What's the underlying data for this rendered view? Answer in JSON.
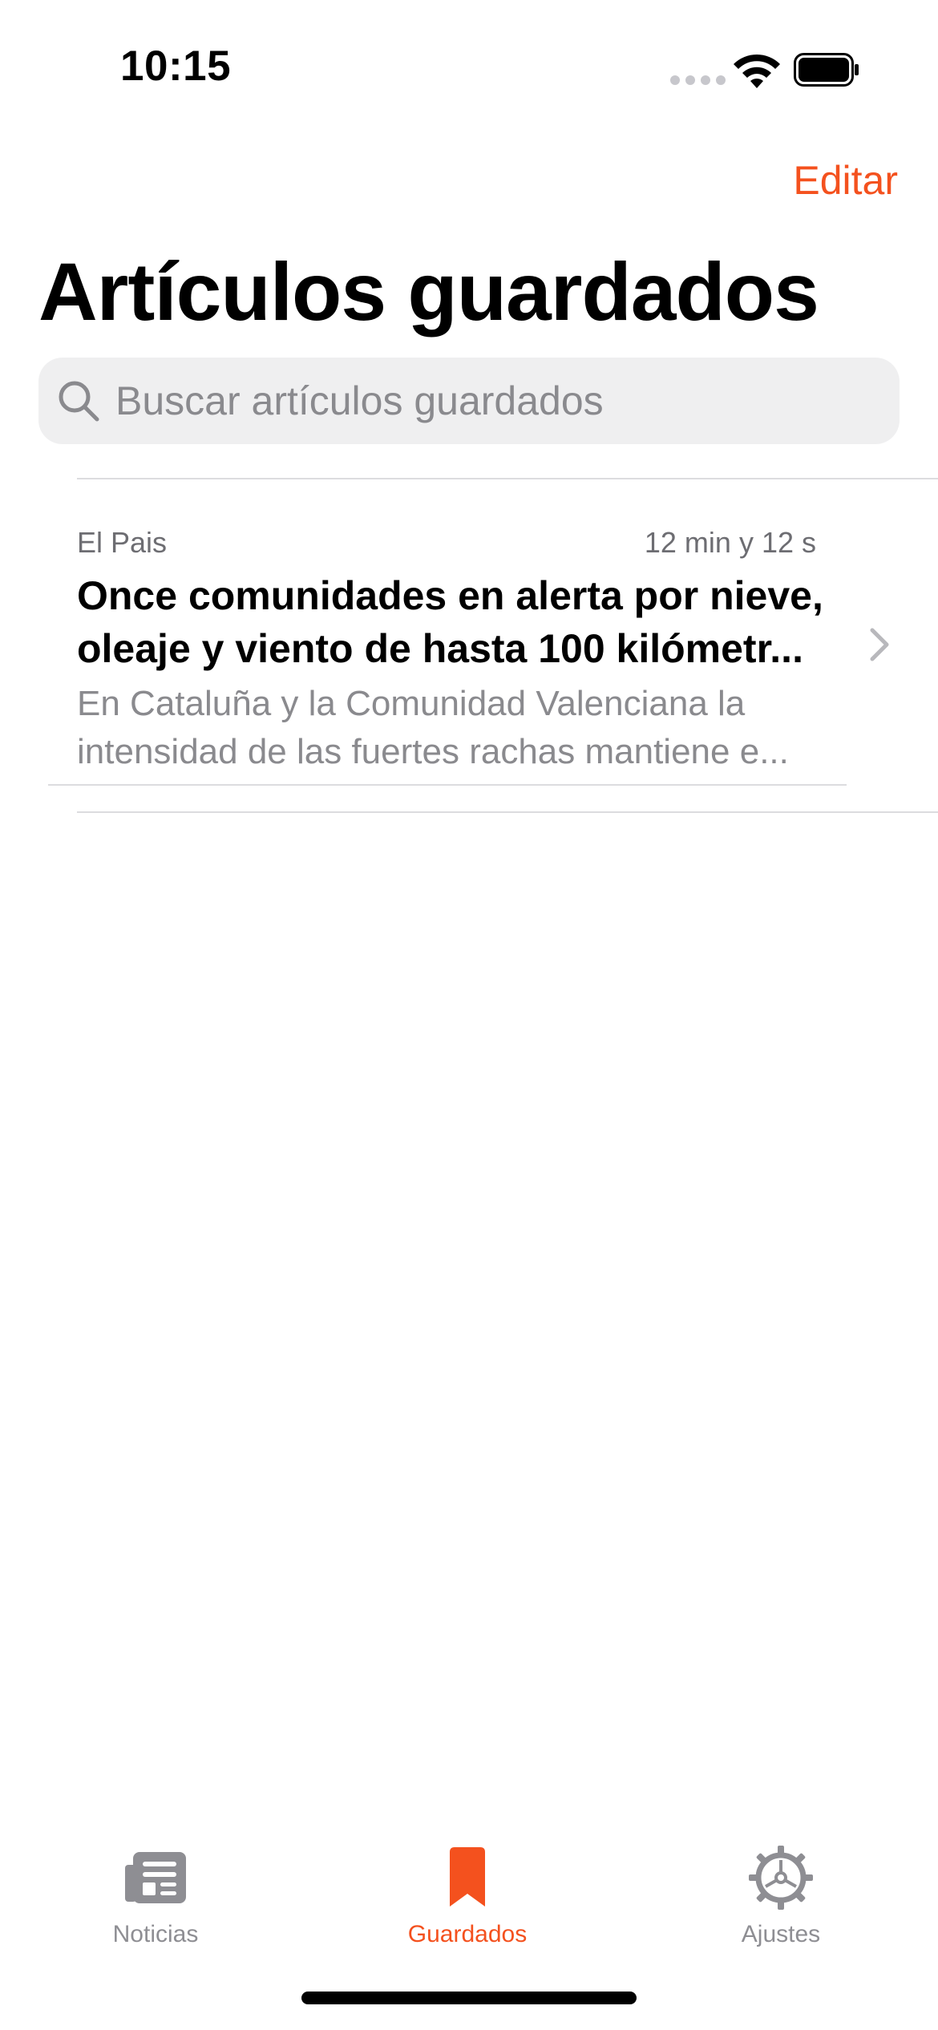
{
  "status_bar": {
    "time": "10:15"
  },
  "nav": {
    "edit_label": "Editar",
    "title": "Artículos guardados"
  },
  "search": {
    "placeholder": "Buscar artículos guardados"
  },
  "articles": [
    {
      "source": "El Pais",
      "time": "12 min y 12 s",
      "title_lines": [
        "Once comunidades en alerta por nieve,",
        "oleaje y viento de hasta 100 kilómetr..."
      ],
      "summary_lines": [
        "En Cataluña y la Comunidad Valenciana la",
        "intensidad de las fuertes rachas mantiene e..."
      ]
    }
  ],
  "tabs": [
    {
      "label": "Noticias",
      "icon": "newspaper-icon",
      "active": false
    },
    {
      "label": "Guardados",
      "icon": "bookmark-icon",
      "active": true
    },
    {
      "label": "Ajustes",
      "icon": "gear-icon",
      "active": false
    }
  ],
  "colors": {
    "accent": "#f4511e",
    "inactive": "#8e8e93",
    "secondary_text": "#8a8a8e"
  }
}
